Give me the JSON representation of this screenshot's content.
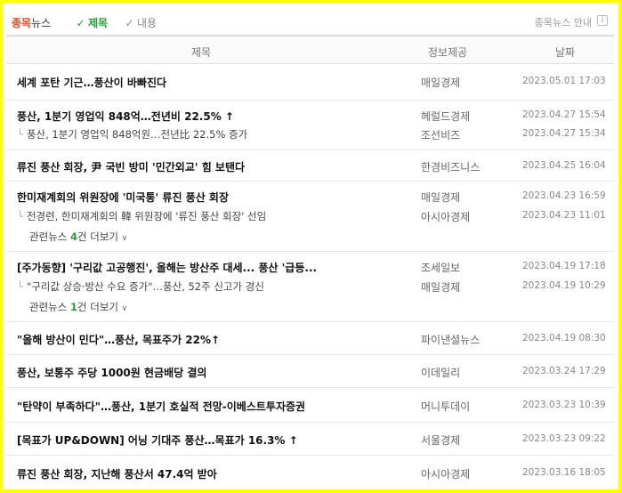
{
  "tabs": {
    "title_part1": "종목",
    "title_part2": "뉴스",
    "sort_active": "제목",
    "sort_inactive": "내용",
    "guide": "종목뉴스 안내",
    "info_icon": "i"
  },
  "header": {
    "title": "제목",
    "source": "정보제공",
    "date": "날짜"
  },
  "groups": [
    {
      "main": {
        "title": "세계 포탄 기근…풍산이 바빠진다",
        "source": "매일경제",
        "date": "2023.05.01 17:03"
      }
    },
    {
      "main": {
        "title": "풍산, 1분기 영업익 848억…전년비 22.5% ↑",
        "source": "헤럴드경제",
        "date": "2023.04.27 15:54"
      },
      "sub": {
        "title": "풍산, 1분기 영업익 848억원…전년比 22.5% 증가",
        "source": "조선비즈",
        "date": "2023.04.27 15:34"
      }
    },
    {
      "main": {
        "title": "류진 풍산 회장, 尹 국빈 방미 '민간외교' 힘 보탠다",
        "source": "한경비즈니스",
        "date": "2023.04.25 16:04"
      }
    },
    {
      "main": {
        "title": "한미재계회의 위원장에 '미국통' 류진 풍산 회장",
        "source": "매일경제",
        "date": "2023.04.23 16:59"
      },
      "sub": {
        "title": "전경련, 한미재계회의 韓 위원장에 '류진 풍산 회장' 선임",
        "source": "아시아경제",
        "date": "2023.04.23 11:01"
      },
      "related": {
        "prefix": "관련뉴스 ",
        "count": "4",
        "suffix": "건 더보기",
        "chev": "∨"
      }
    },
    {
      "main": {
        "title": "[주가동향] '구리값 고공행진', 올해는 방산주 대세... 풍산 '급등...",
        "source": "조세일보",
        "date": "2023.04.19 17:18"
      },
      "sub": {
        "title": "\"구리값 상승·방산 수요 증가\"…풍산, 52주 신고가 경신",
        "source": "매일경제",
        "date": "2023.04.19 10:29"
      },
      "related": {
        "prefix": "관련뉴스 ",
        "count": "1",
        "suffix": "건 더보기",
        "chev": "∨"
      }
    },
    {
      "main": {
        "title": "\"올해 방산이 민다\"…풍산, 목표주가 22%↑",
        "source": "파이낸셜뉴스",
        "date": "2023.04.19 08:30"
      }
    },
    {
      "main": {
        "title": "풍산, 보통주 주당 1000원 현금배당 결의",
        "source": "이데일리",
        "date": "2023.03.24 17:29"
      }
    },
    {
      "main": {
        "title": "\"탄약이 부족하다\"…풍산, 1분기 호실적 전망-이베스트투자증권",
        "source": "머니투데이",
        "date": "2023.03.23 10:39"
      }
    },
    {
      "main": {
        "title": "[목표가 UP&DOWN] 어닝 기대주 풍산…목표가 16.3% ↑",
        "source": "서울경제",
        "date": "2023.03.23 09:22"
      }
    },
    {
      "main": {
        "title": "류진 풍산 회장, 지난해 풍산서 47.4억 받아",
        "source": "아시아경제",
        "date": "2023.03.16 18:05"
      }
    }
  ]
}
